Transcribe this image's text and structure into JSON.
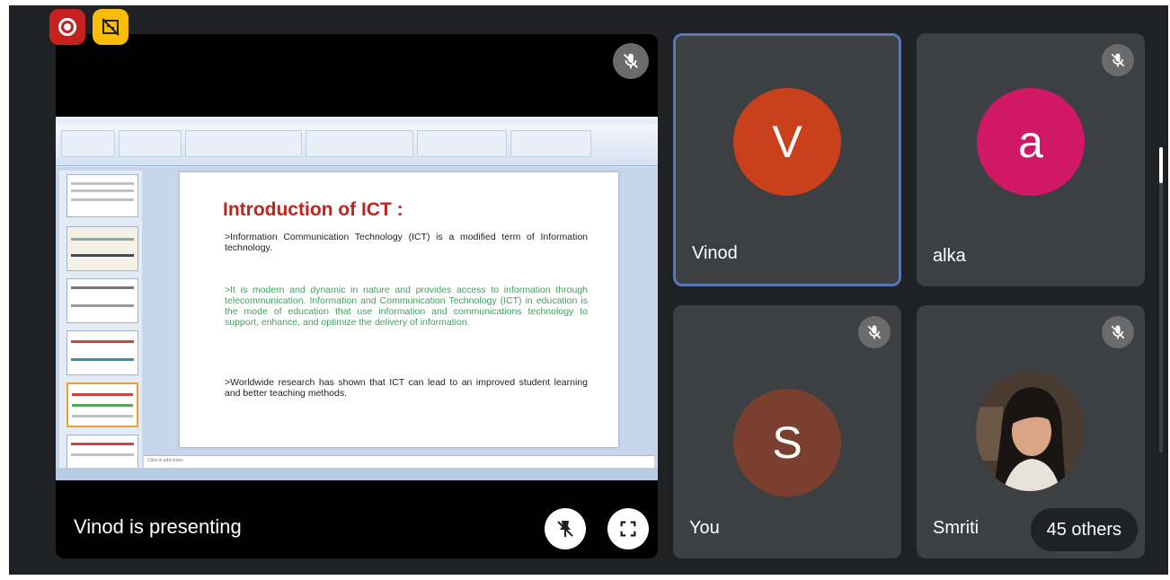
{
  "top_icons": {
    "recording": "recording-icon",
    "no_capture": "no-capture-icon"
  },
  "main": {
    "presenter_label": "Vinod is presenting",
    "shared_slide": {
      "title": "Introduction of  ICT :",
      "paragraphs": [
        ">Information Communication Technology (ICT) is a modified term of Information technology.",
        ">It is modern and dynamic in nature and provides access to information through telecommunication. Information and Communication Technology (ICT) in education is the mode of education that use information and communications technology to support, enhance, and optimize the delivery of information.",
        ">Worldwide research has shown that ICT can lead to an improved student learning and better teaching methods."
      ],
      "notes_placeholder": "Click to add notes"
    }
  },
  "participants": [
    {
      "name": "Vinod",
      "initial": "V",
      "color": "#c8401c",
      "active": true
    },
    {
      "name": "alka",
      "initial": "a",
      "color": "#d11866",
      "muted": true
    },
    {
      "name": "You",
      "initial": "S",
      "color": "#7a3f2e",
      "muted": true
    },
    {
      "name": "Smriti",
      "muted": true,
      "others_label": "45 others"
    }
  ],
  "colors": {
    "background": "#202124",
    "tile": "#3c4043",
    "active_border": "#5878b5",
    "slide_title": "#c0241c",
    "slide_green": "#3aa55a"
  }
}
